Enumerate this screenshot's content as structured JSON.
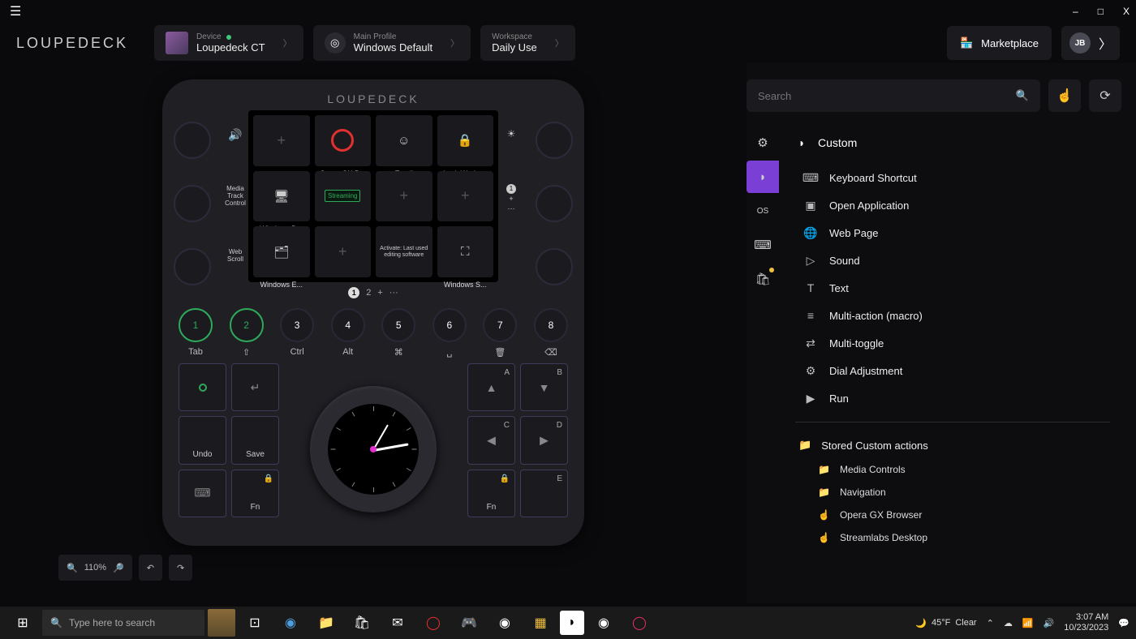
{
  "window": {
    "minimize": "–",
    "maximize": "□",
    "close": "X"
  },
  "header": {
    "logo": "LOUPEDECK",
    "device_label": "Device",
    "device_value": "Loupedeck CT",
    "profile_label": "Main Profile",
    "profile_value": "Windows Default",
    "workspace_label": "Workspace",
    "workspace_value": "Daily Use",
    "marketplace": "Marketplace",
    "user_initials": "JB"
  },
  "search": {
    "placeholder": "Search"
  },
  "device": {
    "logo": "LOUPEDECK",
    "side_labels": {
      "media": "Media Track Control",
      "scroll": "Web Scroll",
      "page1": "1",
      "page_plus": "+",
      "page_dots": "···"
    },
    "screen_tiles": [
      [
        {
          "label": "Opera GX B...",
          "icon": "opera"
        },
        {
          "label": "Emoji",
          "icon": "emoji"
        },
        {
          "label": "Lock Works...",
          "icon": "lock"
        },
        {
          "label": "",
          "icon": "empty"
        }
      ],
      [
        {
          "label": "Windows D...",
          "icon": "desktop"
        },
        {
          "label": "Streaming",
          "icon": "stream"
        },
        {
          "label": "",
          "icon": "empty"
        },
        {
          "label": "",
          "icon": "empty"
        }
      ],
      [
        {
          "label": "Windows E...",
          "icon": "explorer"
        },
        {
          "label": "",
          "icon": "empty"
        },
        {
          "label": "Activate: Last used editing software",
          "icon": "text"
        },
        {
          "label": "Windows S...",
          "icon": "snap"
        }
      ]
    ],
    "pager": {
      "p1": "1",
      "p2": "2",
      "plus": "+",
      "more": "···"
    },
    "num_buttons": [
      "1",
      "2",
      "3",
      "4",
      "5",
      "6",
      "7",
      "8"
    ],
    "num_active": [
      0,
      1
    ],
    "label_row": [
      "Tab",
      "⇧",
      "Ctrl",
      "Alt",
      "⌘",
      "␣",
      "🗑",
      "⌫"
    ],
    "squares_left": [
      {
        "main": "",
        "center": "dot"
      },
      {
        "main": "",
        "center": "↵"
      },
      {
        "main": "Undo"
      },
      {
        "main": "Save"
      },
      {
        "main": "",
        "center": "⌨"
      },
      {
        "main": "Fn",
        "corner": "🔒"
      }
    ],
    "squares_right": [
      {
        "main": "",
        "center": "▲",
        "corner": "A"
      },
      {
        "main": "",
        "center": "▼",
        "corner": "B"
      },
      {
        "main": "",
        "center": "◀",
        "corner": "C"
      },
      {
        "main": "",
        "center": "▶",
        "corner": "D"
      },
      {
        "main": "Fn",
        "corner": "🔒"
      },
      {
        "main": "",
        "corner": "E"
      }
    ]
  },
  "zoom": {
    "out": "−",
    "value": "110%",
    "in": "+",
    "undo": "↶",
    "redo": "↷"
  },
  "panel": {
    "title": "Custom",
    "actions": [
      {
        "icon": "⌨",
        "label": "Keyboard Shortcut"
      },
      {
        "icon": "▣",
        "label": "Open Application"
      },
      {
        "icon": "🌐",
        "label": "Web Page"
      },
      {
        "icon": "▷",
        "label": "Sound"
      },
      {
        "icon": "T",
        "label": "Text"
      },
      {
        "icon": "≡",
        "label": "Multi-action (macro)"
      },
      {
        "icon": "⇄",
        "label": "Multi-toggle"
      },
      {
        "icon": "⚙",
        "label": "Dial Adjustment"
      },
      {
        "icon": "▶",
        "label": "Run"
      }
    ],
    "stored_title": "Stored Custom actions",
    "stored": [
      {
        "icon": "📁",
        "label": "Media Controls"
      },
      {
        "icon": "📁",
        "label": "Navigation"
      },
      {
        "icon": "☝",
        "label": "Opera GX Browser"
      },
      {
        "icon": "☝",
        "label": "Streamlabs Desktop"
      }
    ]
  },
  "taskbar": {
    "search_placeholder": "Type here to search",
    "weather_temp": "45°F",
    "weather_cond": "Clear",
    "time": "3:07 AM",
    "date": "10/23/2023"
  }
}
